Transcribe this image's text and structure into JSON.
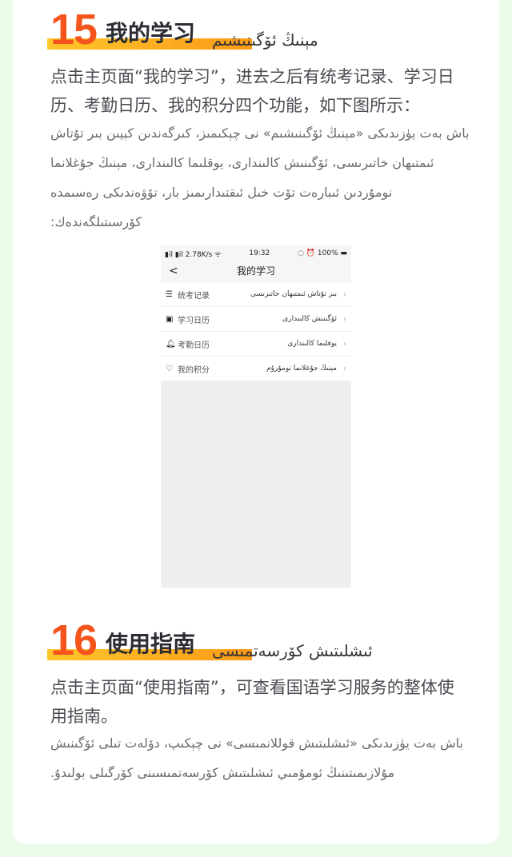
{
  "colors": {
    "background": "#ebfdea",
    "number": "#f6541d",
    "highlight": "#fdc62a"
  },
  "sections": [
    {
      "number": "15",
      "title_zh": "我的学习",
      "title_ug": "مېنىڭ ئۆگىنىشىم",
      "body_zh": "点击主页面“我的学习”，进去之后有统考记录、学习日历、考勤日历、我的积分四个功能，如下图所示：",
      "body_ug": "باش بەت يۈزىدىكى «مېنىڭ ئۆگىنىشىم» نى چېكىمىز، كىرگەندىن كېيىن بىر تۇتاش ئىمتىھان خاتىرىسى، ئۆگىنىش كالىندارى، يوقلىما كالىندارى، مېنىڭ جۇغلانما نومۇردىن ئىبارەت تۆت خىل ئىقتىدارىمىز بار، تۆۋەندىكى رەسىمدە كۆرسىتىلگەندەك:"
    },
    {
      "number": "16",
      "title_zh": "使用指南",
      "title_ug": "ئىشلىتىش كۆرسەتمىسى",
      "body_zh": "点击主页面“使用指南”，可查看国语学习服务的整体使用指南。",
      "body_ug": "باش بەت يۈزىدىكى «ئىشلىتىش قوللانمىسى» نى چېكىپ، دۆلەت تىلى ئۆگىنىش مۇلازىمىتىنىڭ ئومۇمىي ئىشلىتىش كۆرسەتمىسىنى كۆرگىلى بولىدۇ."
    }
  ],
  "phone": {
    "status_left": "▮il ▮il 2.78K/s ᯤ",
    "time": "19:32",
    "status_right": "◌ ⏰ 100% ▬",
    "title": "我的学习",
    "back_icon": "chevron-left",
    "items": [
      {
        "icon": "list-icon",
        "label": "统考记录",
        "ug": "بىر تۇتاش ئىمتىھان خاتىرىسى"
      },
      {
        "icon": "calendar-icon",
        "label": "学习日历",
        "ug": "ئۆگىنىش كالىندارى"
      },
      {
        "icon": "bell-icon",
        "label": "考勤日历",
        "ug": "يوقلىما كالىندارى"
      },
      {
        "icon": "diamond-icon",
        "label": "我的积分",
        "ug": "مېنىڭ جۇغلانما نومۇرۇم"
      }
    ]
  }
}
